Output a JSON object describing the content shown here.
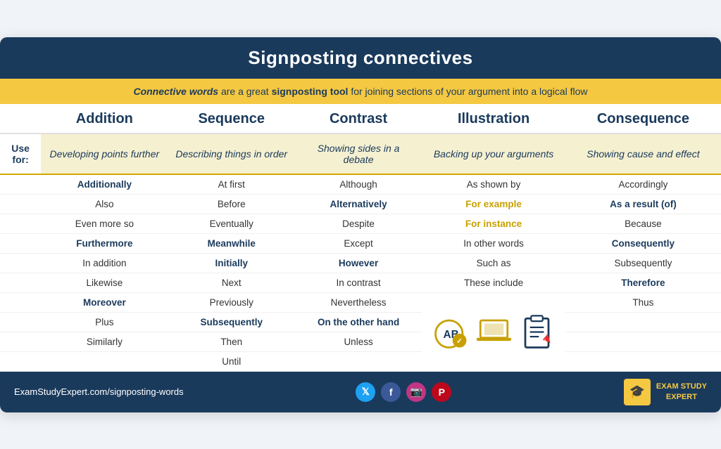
{
  "title": "Signposting connectives",
  "subtitle": {
    "part1": "Connective words",
    "part2": " are a great ",
    "part3": "signposting tool",
    "part4": " for joining sections of your argument into a logical flow"
  },
  "columns": [
    {
      "id": "addition",
      "label": "Addition",
      "use_for": "Developing points further"
    },
    {
      "id": "sequence",
      "label": "Sequence",
      "use_for": "Describing things in order"
    },
    {
      "id": "contrast",
      "label": "Contrast",
      "use_for": "Showing sides in a debate"
    },
    {
      "id": "illustration",
      "label": "Illustration",
      "use_for": "Backing up your arguments"
    },
    {
      "id": "consequence",
      "label": "Consequence",
      "use_for": "Showing cause and effect"
    }
  ],
  "use_for_label": "Use for:",
  "words": {
    "addition": [
      {
        "text": "Additionally",
        "bold": true
      },
      {
        "text": "Also",
        "bold": false
      },
      {
        "text": "Even more so",
        "bold": false
      },
      {
        "text": "Furthermore",
        "bold": true
      },
      {
        "text": "In addition",
        "bold": false
      },
      {
        "text": "Likewise",
        "bold": false
      },
      {
        "text": "Moreover",
        "bold": true
      },
      {
        "text": "Plus",
        "bold": false
      },
      {
        "text": "Similarly",
        "bold": false
      }
    ],
    "sequence": [
      {
        "text": "At first",
        "bold": false
      },
      {
        "text": "Before",
        "bold": false
      },
      {
        "text": "Eventually",
        "bold": false
      },
      {
        "text": "Meanwhile",
        "bold": true
      },
      {
        "text": "Initially",
        "bold": true
      },
      {
        "text": "Next",
        "bold": false
      },
      {
        "text": "Previously",
        "bold": false
      },
      {
        "text": "Subsequently",
        "bold": true
      },
      {
        "text": "Then",
        "bold": false
      },
      {
        "text": "Until",
        "bold": false
      }
    ],
    "contrast": [
      {
        "text": "Although",
        "bold": false
      },
      {
        "text": "Alternatively",
        "bold": true
      },
      {
        "text": "Despite",
        "bold": false
      },
      {
        "text": "Except",
        "bold": false
      },
      {
        "text": "However",
        "bold": true
      },
      {
        "text": "In contrast",
        "bold": false
      },
      {
        "text": "Nevertheless",
        "bold": false
      },
      {
        "text": "On the other hand",
        "bold": true
      },
      {
        "text": "Unless",
        "bold": false
      }
    ],
    "illustration": [
      {
        "text": "As shown by",
        "bold": false
      },
      {
        "text": "For example",
        "bold": true,
        "gold": true
      },
      {
        "text": "For instance",
        "bold": true,
        "gold": true
      },
      {
        "text": "In other words",
        "bold": false
      },
      {
        "text": "Such as",
        "bold": false
      },
      {
        "text": "These include",
        "bold": false
      }
    ],
    "consequence": [
      {
        "text": "Accordingly",
        "bold": false
      },
      {
        "text": "As a result (of)",
        "bold": true
      },
      {
        "text": "Because",
        "bold": false
      },
      {
        "text": "Consequently",
        "bold": true
      },
      {
        "text": "Subsequently",
        "bold": false
      },
      {
        "text": "Therefore",
        "bold": true
      },
      {
        "text": "Thus",
        "bold": false
      }
    ]
  },
  "footer": {
    "url": "ExamStudyExpert.com/signposting-words",
    "brand_line1": "EXAM STUDY",
    "brand_line2": "EXPERT"
  }
}
